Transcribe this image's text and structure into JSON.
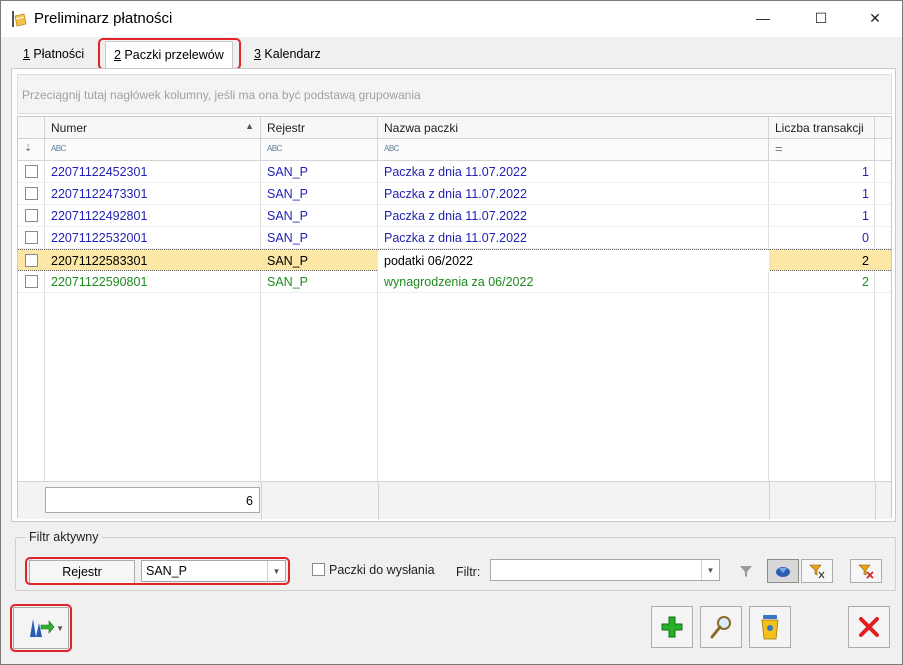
{
  "window": {
    "title": "Preliminarz płatności",
    "minimize": "—",
    "maximize": "☐",
    "close": "✕"
  },
  "tabs": [
    {
      "key": "1",
      "label": " Płatności"
    },
    {
      "key": "2",
      "label": " Paczki przelewów"
    },
    {
      "key": "3",
      "label": " Kalendarz"
    }
  ],
  "grid": {
    "group_hint": "Przeciągnij tutaj nagłówek kolumny, jeśli ma ona być podstawą grupowania",
    "columns": [
      "Numer",
      "Rejestr",
      "Nazwa paczki",
      "Liczba transakcji"
    ],
    "sort_indicator": "▲",
    "filter_row": {
      "pin": "⇣",
      "abc": "ABC",
      "equals": "="
    },
    "rows": [
      {
        "numer": "22071122452301",
        "rejestr": "SAN_P",
        "nazwa": "Paczka z dnia 11.07.2022",
        "liczba": "1",
        "color": "#1f1fb5"
      },
      {
        "numer": "22071122473301",
        "rejestr": "SAN_P",
        "nazwa": "Paczka z dnia 11.07.2022",
        "liczba": "1",
        "color": "#1f1fb5"
      },
      {
        "numer": "22071122492801",
        "rejestr": "SAN_P",
        "nazwa": "Paczka z dnia 11.07.2022",
        "liczba": "1",
        "color": "#1f1fb5"
      },
      {
        "numer": "22071122532001",
        "rejestr": "SAN_P",
        "nazwa": "Paczka z dnia 11.07.2022",
        "liczba": "0",
        "color": "#1f1fb5"
      },
      {
        "numer": "22071122583301",
        "rejestr": "SAN_P",
        "nazwa": "podatki 06/2022",
        "liczba": "2",
        "color": "#000000",
        "selected": true
      },
      {
        "numer": "22071122590801",
        "rejestr": "SAN_P",
        "nazwa": "wynagrodzenia za 06/2022",
        "liczba": "2",
        "color": "#1f8a1f"
      }
    ],
    "count": "6"
  },
  "filter": {
    "group_title": "Filtr aktywny",
    "rejestr_button": "Rejestr",
    "rejestr_value": "SAN_P",
    "paczki_checkbox_label": "Paczki do wysłania",
    "filtr_label": "Filtr:",
    "filtr_value": ""
  },
  "colors": {
    "accent_red": "#e0242a",
    "selection": "#fde7a6",
    "row_blue": "#1f1fb5",
    "row_green": "#1f8a1f"
  }
}
